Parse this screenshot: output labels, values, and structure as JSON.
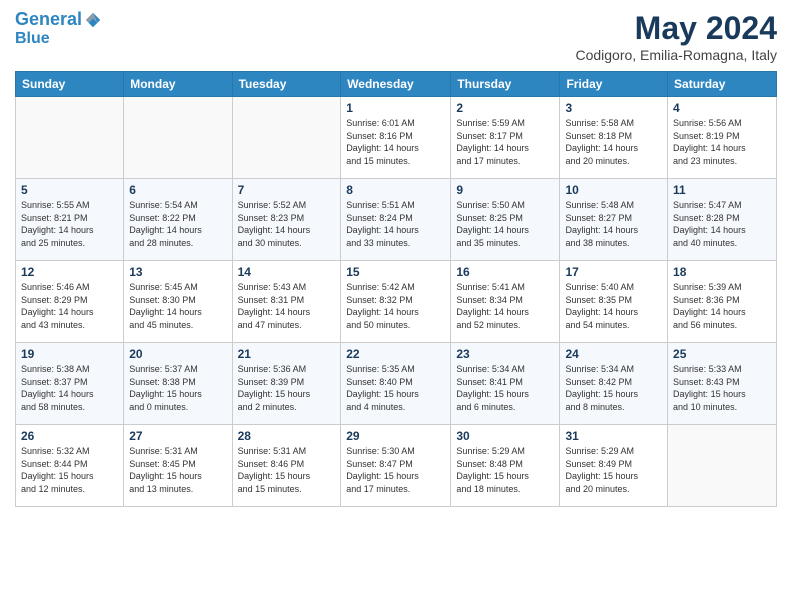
{
  "header": {
    "logo_line1": "General",
    "logo_line2": "Blue",
    "title": "May 2024",
    "subtitle": "Codigoro, Emilia-Romagna, Italy"
  },
  "weekdays": [
    "Sunday",
    "Monday",
    "Tuesday",
    "Wednesday",
    "Thursday",
    "Friday",
    "Saturday"
  ],
  "weeks": [
    [
      {
        "day": "",
        "info": ""
      },
      {
        "day": "",
        "info": ""
      },
      {
        "day": "",
        "info": ""
      },
      {
        "day": "1",
        "info": "Sunrise: 6:01 AM\nSunset: 8:16 PM\nDaylight: 14 hours\nand 15 minutes."
      },
      {
        "day": "2",
        "info": "Sunrise: 5:59 AM\nSunset: 8:17 PM\nDaylight: 14 hours\nand 17 minutes."
      },
      {
        "day": "3",
        "info": "Sunrise: 5:58 AM\nSunset: 8:18 PM\nDaylight: 14 hours\nand 20 minutes."
      },
      {
        "day": "4",
        "info": "Sunrise: 5:56 AM\nSunset: 8:19 PM\nDaylight: 14 hours\nand 23 minutes."
      }
    ],
    [
      {
        "day": "5",
        "info": "Sunrise: 5:55 AM\nSunset: 8:21 PM\nDaylight: 14 hours\nand 25 minutes."
      },
      {
        "day": "6",
        "info": "Sunrise: 5:54 AM\nSunset: 8:22 PM\nDaylight: 14 hours\nand 28 minutes."
      },
      {
        "day": "7",
        "info": "Sunrise: 5:52 AM\nSunset: 8:23 PM\nDaylight: 14 hours\nand 30 minutes."
      },
      {
        "day": "8",
        "info": "Sunrise: 5:51 AM\nSunset: 8:24 PM\nDaylight: 14 hours\nand 33 minutes."
      },
      {
        "day": "9",
        "info": "Sunrise: 5:50 AM\nSunset: 8:25 PM\nDaylight: 14 hours\nand 35 minutes."
      },
      {
        "day": "10",
        "info": "Sunrise: 5:48 AM\nSunset: 8:27 PM\nDaylight: 14 hours\nand 38 minutes."
      },
      {
        "day": "11",
        "info": "Sunrise: 5:47 AM\nSunset: 8:28 PM\nDaylight: 14 hours\nand 40 minutes."
      }
    ],
    [
      {
        "day": "12",
        "info": "Sunrise: 5:46 AM\nSunset: 8:29 PM\nDaylight: 14 hours\nand 43 minutes."
      },
      {
        "day": "13",
        "info": "Sunrise: 5:45 AM\nSunset: 8:30 PM\nDaylight: 14 hours\nand 45 minutes."
      },
      {
        "day": "14",
        "info": "Sunrise: 5:43 AM\nSunset: 8:31 PM\nDaylight: 14 hours\nand 47 minutes."
      },
      {
        "day": "15",
        "info": "Sunrise: 5:42 AM\nSunset: 8:32 PM\nDaylight: 14 hours\nand 50 minutes."
      },
      {
        "day": "16",
        "info": "Sunrise: 5:41 AM\nSunset: 8:34 PM\nDaylight: 14 hours\nand 52 minutes."
      },
      {
        "day": "17",
        "info": "Sunrise: 5:40 AM\nSunset: 8:35 PM\nDaylight: 14 hours\nand 54 minutes."
      },
      {
        "day": "18",
        "info": "Sunrise: 5:39 AM\nSunset: 8:36 PM\nDaylight: 14 hours\nand 56 minutes."
      }
    ],
    [
      {
        "day": "19",
        "info": "Sunrise: 5:38 AM\nSunset: 8:37 PM\nDaylight: 14 hours\nand 58 minutes."
      },
      {
        "day": "20",
        "info": "Sunrise: 5:37 AM\nSunset: 8:38 PM\nDaylight: 15 hours\nand 0 minutes."
      },
      {
        "day": "21",
        "info": "Sunrise: 5:36 AM\nSunset: 8:39 PM\nDaylight: 15 hours\nand 2 minutes."
      },
      {
        "day": "22",
        "info": "Sunrise: 5:35 AM\nSunset: 8:40 PM\nDaylight: 15 hours\nand 4 minutes."
      },
      {
        "day": "23",
        "info": "Sunrise: 5:34 AM\nSunset: 8:41 PM\nDaylight: 15 hours\nand 6 minutes."
      },
      {
        "day": "24",
        "info": "Sunrise: 5:34 AM\nSunset: 8:42 PM\nDaylight: 15 hours\nand 8 minutes."
      },
      {
        "day": "25",
        "info": "Sunrise: 5:33 AM\nSunset: 8:43 PM\nDaylight: 15 hours\nand 10 minutes."
      }
    ],
    [
      {
        "day": "26",
        "info": "Sunrise: 5:32 AM\nSunset: 8:44 PM\nDaylight: 15 hours\nand 12 minutes."
      },
      {
        "day": "27",
        "info": "Sunrise: 5:31 AM\nSunset: 8:45 PM\nDaylight: 15 hours\nand 13 minutes."
      },
      {
        "day": "28",
        "info": "Sunrise: 5:31 AM\nSunset: 8:46 PM\nDaylight: 15 hours\nand 15 minutes."
      },
      {
        "day": "29",
        "info": "Sunrise: 5:30 AM\nSunset: 8:47 PM\nDaylight: 15 hours\nand 17 minutes."
      },
      {
        "day": "30",
        "info": "Sunrise: 5:29 AM\nSunset: 8:48 PM\nDaylight: 15 hours\nand 18 minutes."
      },
      {
        "day": "31",
        "info": "Sunrise: 5:29 AM\nSunset: 8:49 PM\nDaylight: 15 hours\nand 20 minutes."
      },
      {
        "day": "",
        "info": ""
      }
    ]
  ]
}
